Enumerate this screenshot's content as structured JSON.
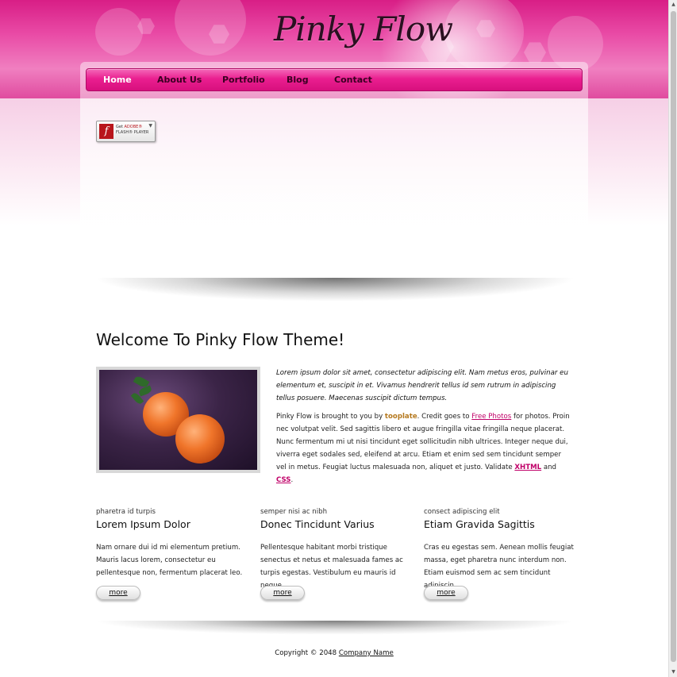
{
  "site": {
    "logo": "Pinky Flow"
  },
  "nav": {
    "items": [
      {
        "label": "Home",
        "active": true
      },
      {
        "label": "About Us"
      },
      {
        "label": "Portfolio"
      },
      {
        "label": "Blog"
      },
      {
        "label": "Contact"
      }
    ]
  },
  "flash_badge": {
    "line1": "Get ",
    "brand": "ADOBE®",
    "line2": "FLASH® PLAYER"
  },
  "welcome": {
    "title": "Welcome To Pinky Flow Theme!",
    "intro": "Lorem ipsum dolor sit amet, consectetur adipiscing elit. Nam metus eros, pulvinar eu elementum et, suscipit in et. Vivamus hendrerit tellus id sem rutrum in adipiscing tellus posuere. Maecenas suscipit dictum tempus.",
    "body_prefix": "Pinky Flow is brought to you by ",
    "body_brand": "tooplate",
    "body_mid1": ". Credit goes to ",
    "body_link_photos": "Free Photos",
    "body_mid2": " for photos. Proin nec volutpat velit. Sed sagittis libero et augue fringilla vitae fringilla neque placerat. Nunc fermentum mi ut nisi tincidunt eget sollicitudin nibh ultrices. Integer neque dui, viverra eget sodales sed, eleifend at arcu. Etiam et enim sed sem tincidunt semper vel in metus. Feugiat luctus malesuada non, aliquet et justo. Validate ",
    "body_link_xhtml": "XHTML",
    "body_and": " and ",
    "body_link_css": "CSS",
    "body_end": "."
  },
  "columns": [
    {
      "kicker": "pharetra id turpis",
      "title": "Lorem Ipsum Dolor",
      "text": "Nam ornare dui id mi elementum pretium. Mauris lacus lorem, consectetur eu pellentesque non, fermentum placerat leo.",
      "button": "more"
    },
    {
      "kicker": "semper nisi ac nibh",
      "title": "Donec Tincidunt Varius",
      "text": "Pellentesque habitant morbi tristique senectus et netus et malesuada fames ac turpis egestas. Vestibulum eu mauris id neque.",
      "button": "more"
    },
    {
      "kicker": "consect adipiscing elit",
      "title": "Etiam Gravida Sagittis",
      "text": "Cras eu egestas sem. Aenean mollis feugiat massa, eget pharetra nunc interdum non. Etiam euismod sem ac sem tincidunt adipiscin.",
      "button": "more"
    }
  ],
  "footer": {
    "prefix": "Copyright © 2048 ",
    "link": "Company Name"
  },
  "colors": {
    "brand_pink": "#ea1f90",
    "link": "#c00068",
    "brand_accent": "#b5791f"
  }
}
